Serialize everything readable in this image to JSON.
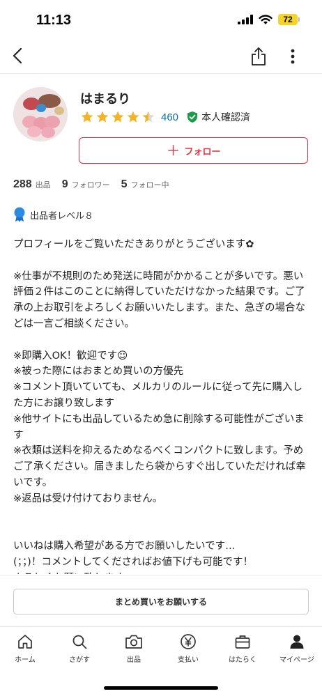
{
  "status_bar": {
    "time": "11:13",
    "battery": "72"
  },
  "profile": {
    "name": "はまるり",
    "rating_stars": 4.5,
    "rating_count": "460",
    "verified_label": "本人確認済",
    "follow_button": "フォロー"
  },
  "stats": [
    {
      "count": "288",
      "label": "出品"
    },
    {
      "count": "9",
      "label": "フォロワー"
    },
    {
      "count": "5",
      "label": "フォロー中"
    }
  ],
  "level": "出品者レベル８",
  "bio": "プロフィールをご覧いただきありがとうございます✿\n\n※仕事が不規則のため発送に時間がかかることが多いです。悪い評価２件はこのことに納得していただけなかった結果です。ご了承の上お取引をよろしくお願いいたします。また、急ぎの場合などは一言ご相談ください。\n\n※即購入OK！歓迎です☺\n※被った際にはおまとめ買いの方優先\n※コメント頂いていても、メルカリのルールに従って先に購入した方にお譲り致します\n※他サイトにも出品しているため急に削除する可能性がございます\n※衣類は送料を抑えるためなるべくコンパクトに致します。予めご了承ください。届きましたら袋からすぐ出していただければ幸いです。\n※返品は受け付けておりません。\n\n\nいいねは購入希望がある方でお願いしたいです…\n(；；)！コメントしてくださればお値下げも可能です！\nよろしくお願い致します",
  "bulk_button": "まとめ買いをお願いする",
  "tabs": [
    {
      "label": "ホーム",
      "icon": "home-icon"
    },
    {
      "label": "さがす",
      "icon": "search-icon"
    },
    {
      "label": "出品",
      "icon": "camera-icon"
    },
    {
      "label": "支払い",
      "icon": "yen-icon"
    },
    {
      "label": "はたらく",
      "icon": "briefcase-icon"
    },
    {
      "label": "マイページ",
      "icon": "person-icon"
    }
  ],
  "colors": {
    "accent_red": "#e0313c",
    "link_blue": "#0a6ebd",
    "star": "#f5b324",
    "verified_green": "#1a9c4a",
    "badge_blue": "#2a8be0"
  }
}
